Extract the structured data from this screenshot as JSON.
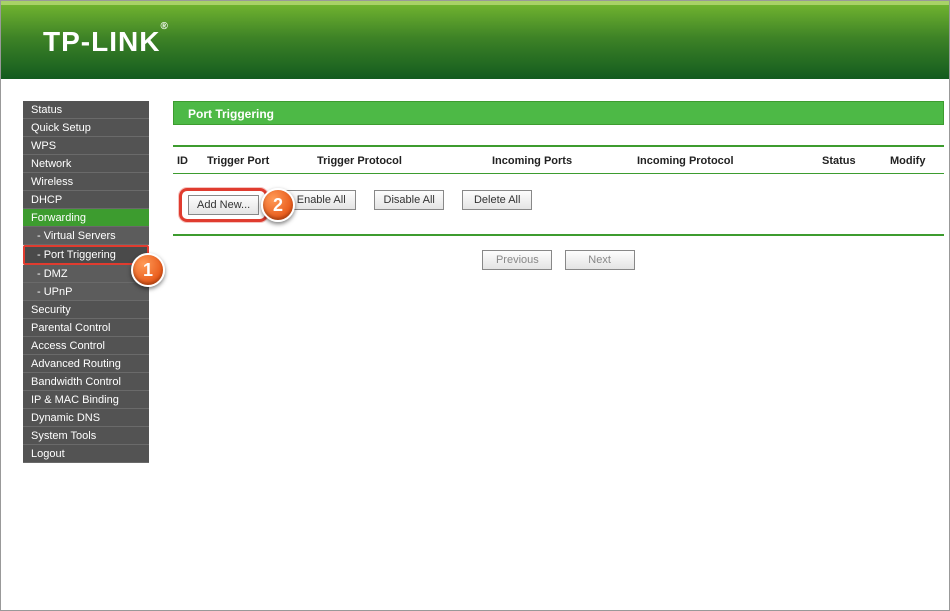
{
  "brand": "TP-LINK",
  "sidebar": {
    "items": [
      {
        "label": "Status",
        "type": "item"
      },
      {
        "label": "Quick Setup",
        "type": "item"
      },
      {
        "label": "WPS",
        "type": "item"
      },
      {
        "label": "Network",
        "type": "item"
      },
      {
        "label": "Wireless",
        "type": "item"
      },
      {
        "label": "DHCP",
        "type": "item"
      },
      {
        "label": "Forwarding",
        "type": "active"
      },
      {
        "label": "- Virtual Servers",
        "type": "sub"
      },
      {
        "label": "- Port Triggering",
        "type": "sub-selected"
      },
      {
        "label": "- DMZ",
        "type": "sub"
      },
      {
        "label": "- UPnP",
        "type": "sub"
      },
      {
        "label": "Security",
        "type": "item"
      },
      {
        "label": "Parental Control",
        "type": "item"
      },
      {
        "label": "Access Control",
        "type": "item"
      },
      {
        "label": "Advanced Routing",
        "type": "item"
      },
      {
        "label": "Bandwidth Control",
        "type": "item"
      },
      {
        "label": "IP & MAC Binding",
        "type": "item"
      },
      {
        "label": "Dynamic DNS",
        "type": "item"
      },
      {
        "label": "System Tools",
        "type": "item"
      },
      {
        "label": "Logout",
        "type": "item"
      }
    ]
  },
  "page": {
    "title": "Port Triggering",
    "columns": {
      "id": "ID",
      "trigger_port": "Trigger Port",
      "trigger_proto": "Trigger Protocol",
      "incoming_ports": "Incoming Ports",
      "incoming_proto": "Incoming Protocol",
      "status": "Status",
      "modify": "Modify"
    },
    "buttons": {
      "add_new": "Add New...",
      "enable_all": "Enable All",
      "disable_all": "Disable All",
      "delete_all": "Delete All",
      "previous": "Previous",
      "next": "Next"
    }
  },
  "callouts": {
    "one": "1",
    "two": "2"
  }
}
